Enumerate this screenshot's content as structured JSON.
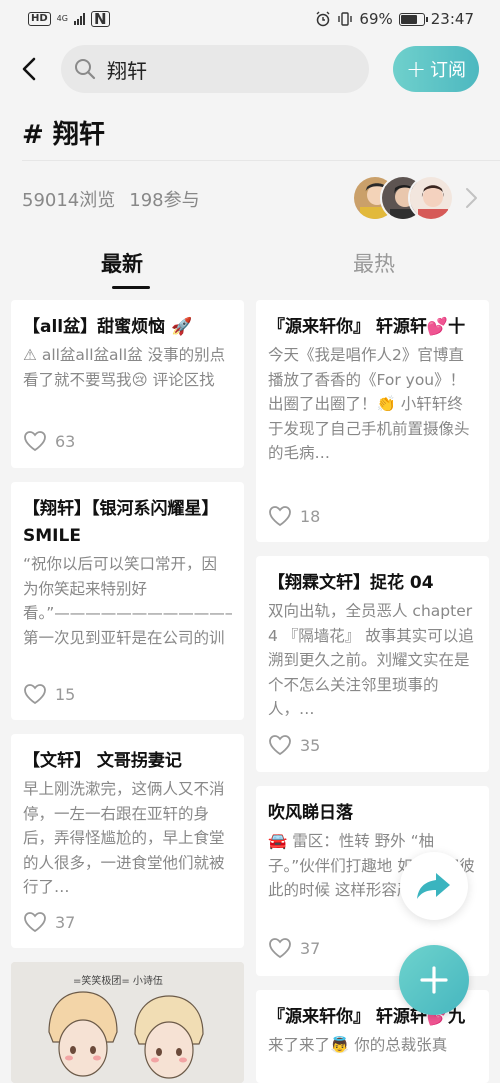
{
  "status_bar": {
    "left_badges": [
      "HD",
      "4G",
      "N"
    ],
    "battery": "69%",
    "time": "23:47"
  },
  "header": {
    "search_query": "翔轩",
    "subscribe_label": "订阅"
  },
  "topic": {
    "title": "# 翔轩",
    "views": "59014浏览",
    "participants": "198参与"
  },
  "tabs": [
    {
      "label": "最新",
      "active": true
    },
    {
      "label": "最热",
      "active": false
    }
  ],
  "left_column": [
    {
      "title": "【all盆】甜蜜烦恼 🚀",
      "excerpt": "⚠ all盆all盆all盆 没事的别点 看了就不要骂我😢 评论区找",
      "likes": "63"
    },
    {
      "title": "【翔轩】【银河系闪耀星】SMILE",
      "excerpt": "“祝你以后可以笑口常开，因为你笑起来特别好看。”———————————————————————— 第一次见到亚轩是在公司的训练…",
      "likes": "15"
    },
    {
      "title": "【文轩】 文哥拐妻记",
      "excerpt": "早上刚洗漱完，这俩人又不消停，一左一右跟在亚轩的身后，弄得怪尴尬的，早上食堂的人很多，一进食堂他们就被行了…",
      "likes": "37"
    }
  ],
  "image_card": {
    "caption": "=笑笑极团= 小诗伍"
  },
  "right_column": [
    {
      "title": "『源来轩你』 轩源轩💕十",
      "excerpt": "今天《我是唱作人2》官博直播放了香香的《For you》！出圈了出圈了！👏 小轩轩终于发现了自己手机前置摄像头的毛病…",
      "likes": "18"
    },
    {
      "title": "【翔霖文轩】捉花 04",
      "excerpt": "双向出轨，全员恶人 chapter 4 『隔墙花』 故事其实可以追溯到更久之前。刘耀文实在是个不怎么关注邻里琐事的人，…",
      "likes": "35"
    },
    {
      "title": "吹风睇日落",
      "excerpt": "🚘 雷区：性转 野外 “柚子。”伙伴们打趣地 如果形容彼此的时候 这样形容严浩翔。",
      "likes": "37"
    },
    {
      "title": "『源来轩你』 轩源轩💕九",
      "excerpt": "来了来了👼 你的总裁张真",
      "likes": ""
    }
  ]
}
